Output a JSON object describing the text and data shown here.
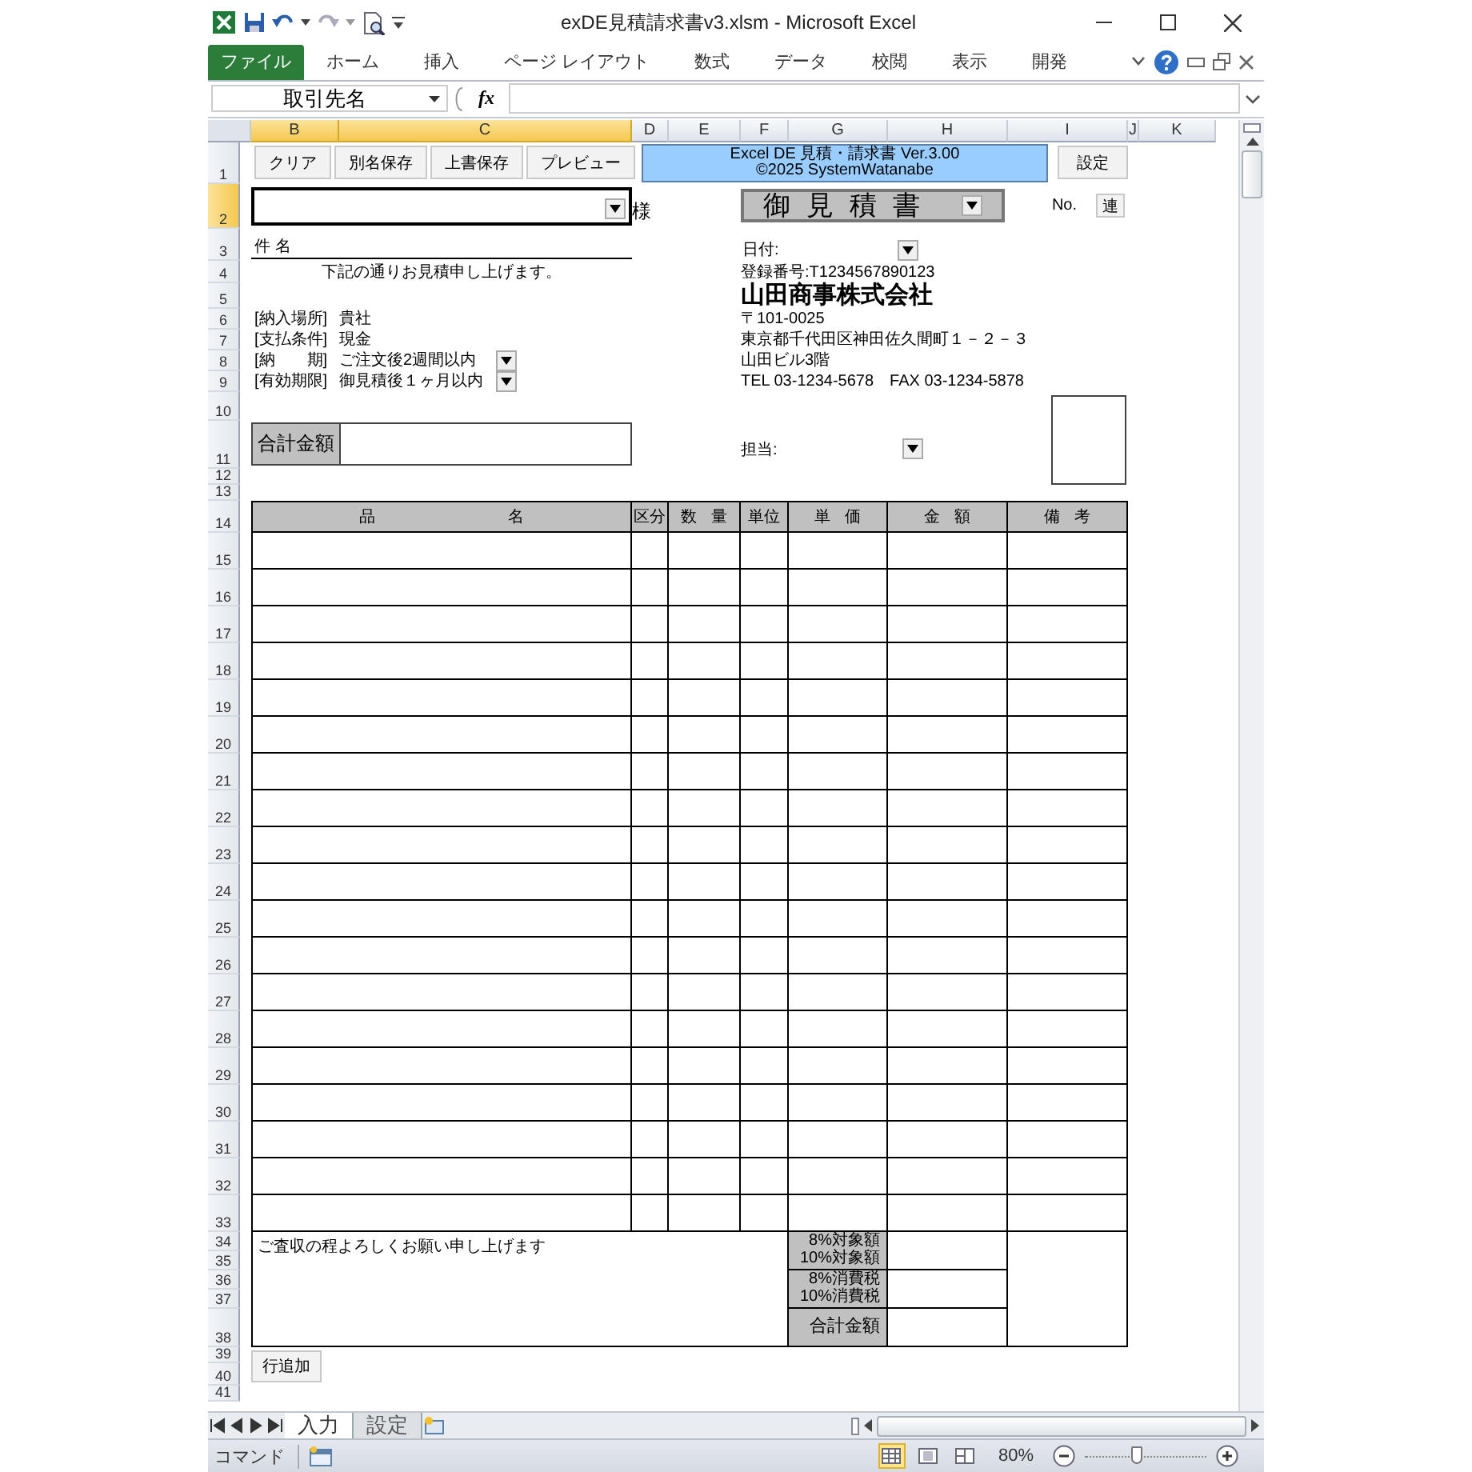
{
  "window": {
    "title": "exDE見積請求書v3.xlsm - Microsoft Excel"
  },
  "ribbon_tabs": [
    {
      "label": "ファイル",
      "selected": true
    },
    {
      "label": "ホーム",
      "selected": false
    },
    {
      "label": "挿入",
      "selected": false
    },
    {
      "label": "ページ レイアウト",
      "selected": false
    },
    {
      "label": "数式",
      "selected": false
    },
    {
      "label": "データ",
      "selected": false
    },
    {
      "label": "校閲",
      "selected": false
    },
    {
      "label": "表示",
      "selected": false
    },
    {
      "label": "開発",
      "selected": false
    }
  ],
  "formula_bar": {
    "name_box": "取引先名",
    "fx": "fx"
  },
  "columns": [
    {
      "label": "B",
      "selected": true
    },
    {
      "label": "C",
      "selected": true
    },
    {
      "label": "D",
      "selected": false
    },
    {
      "label": "E",
      "selected": false
    },
    {
      "label": "F",
      "selected": false
    },
    {
      "label": "G",
      "selected": false
    },
    {
      "label": "H",
      "selected": false
    },
    {
      "label": "I",
      "selected": false
    },
    {
      "label": "J",
      "selected": false
    },
    {
      "label": "K",
      "selected": false
    }
  ],
  "rows": [
    {
      "label": "1",
      "selected": false
    },
    {
      "label": "2",
      "selected": true
    },
    {
      "label": "3",
      "selected": false
    },
    {
      "label": "4",
      "selected": false
    },
    {
      "label": "5",
      "selected": false
    },
    {
      "label": "6",
      "selected": false
    },
    {
      "label": "7",
      "selected": false
    },
    {
      "label": "8",
      "selected": false
    },
    {
      "label": "9",
      "selected": false
    },
    {
      "label": "10",
      "selected": false
    },
    {
      "label": "11",
      "selected": false
    },
    {
      "label": "12",
      "selected": false
    },
    {
      "label": "13",
      "selected": false
    },
    {
      "label": "14",
      "selected": false
    },
    {
      "label": "15",
      "selected": false
    },
    {
      "label": "16",
      "selected": false
    },
    {
      "label": "17",
      "selected": false
    },
    {
      "label": "18",
      "selected": false
    },
    {
      "label": "19",
      "selected": false
    },
    {
      "label": "20",
      "selected": false
    },
    {
      "label": "21",
      "selected": false
    },
    {
      "label": "22",
      "selected": false
    },
    {
      "label": "23",
      "selected": false
    },
    {
      "label": "24",
      "selected": false
    },
    {
      "label": "25",
      "selected": false
    },
    {
      "label": "26",
      "selected": false
    },
    {
      "label": "27",
      "selected": false
    },
    {
      "label": "28",
      "selected": false
    },
    {
      "label": "29",
      "selected": false
    },
    {
      "label": "30",
      "selected": false
    },
    {
      "label": "31",
      "selected": false
    },
    {
      "label": "32",
      "selected": false
    },
    {
      "label": "33",
      "selected": false
    },
    {
      "label": "34",
      "selected": false
    },
    {
      "label": "35",
      "selected": false
    },
    {
      "label": "36",
      "selected": false
    },
    {
      "label": "37",
      "selected": false
    },
    {
      "label": "38",
      "selected": false
    },
    {
      "label": "39",
      "selected": false
    },
    {
      "label": "40",
      "selected": false
    },
    {
      "label": "41",
      "selected": false
    }
  ],
  "sheet": {
    "buttons": [
      "クリア",
      "別名保存",
      "上書保存",
      "プレビュー"
    ],
    "banner": [
      "Excel DE 見積・請求書 Ver.3.00",
      "©2025 SystemWatanabe"
    ],
    "settings_button": "設定",
    "customer_suffix": "様",
    "doc_title": "御見積書",
    "no_label": "No.",
    "no_button": "連",
    "subject_label": "件 名",
    "greeting": "下記の通りお見積申し上げます。",
    "terms": [
      {
        "label": "[納入場所]",
        "value": "貴社",
        "dropdown": false
      },
      {
        "label": "[支払条件]",
        "value": "現金",
        "dropdown": false
      },
      {
        "label": "[納　　期]",
        "value": "ご注文後2週間以内",
        "dropdown": true
      },
      {
        "label": "[有効期限]",
        "value": "御見積後１ヶ月以内",
        "dropdown": true
      }
    ],
    "date_label": "日付:",
    "registration": "登録番号:T1234567890123",
    "company": "山田商事株式会社",
    "address_lines": [
      "〒101-0025",
      "東京都千代田区神田佐久間町１－２－３",
      "山田ビル3階",
      "TEL 03-1234-5678　FAX 03-1234-5878"
    ],
    "total_label": "合計金額",
    "staff_label": "担当:",
    "table": {
      "columns": [
        "品 名",
        "区分",
        "数 量",
        "単位",
        "単 価",
        "金 額",
        "備 考"
      ]
    },
    "note": "ご査収の程よろしくお願い申し上げます",
    "summary": [
      [
        "8%対象額",
        "10%対象額"
      ],
      [
        "8%消費税",
        "10%消費税"
      ],
      [
        "合計金額"
      ]
    ],
    "add_row_button": "行追加"
  },
  "sheet_tabs": [
    {
      "label": "入力",
      "selected": true
    },
    {
      "label": "設定",
      "selected": false
    }
  ],
  "status_bar": {
    "mode": "コマンド",
    "zoom": "80%",
    "zoom_slider": {
      "level": 0.44
    }
  }
}
